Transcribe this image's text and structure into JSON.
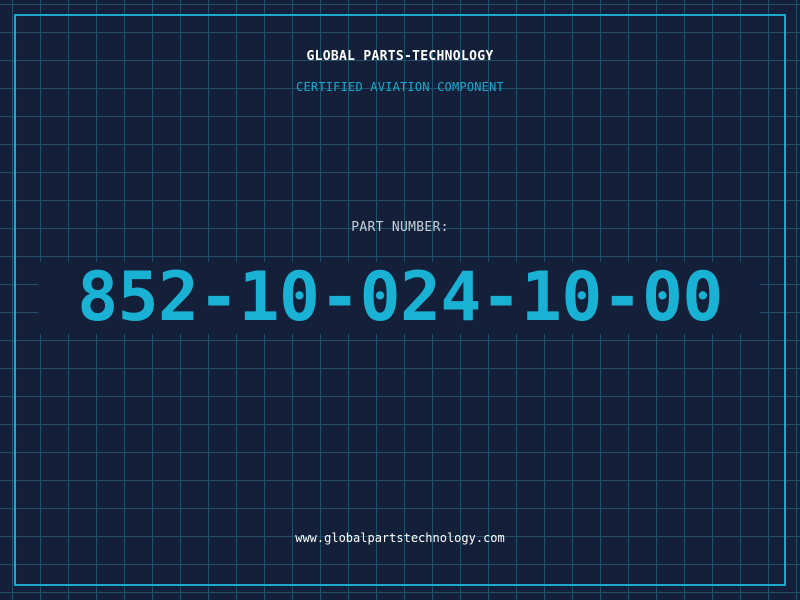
{
  "header": {
    "brand": "GLOBAL PARTS-TECHNOLOGY",
    "subtitle": "CERTIFIED AVIATION COMPONENT"
  },
  "part": {
    "label": "PART NUMBER:",
    "number": "852-10-024-10-00"
  },
  "footer": {
    "url": "www.globalpartstechnology.com"
  },
  "colors": {
    "background": "#14203a",
    "grid": "#22506a",
    "accent": "#1aa9cc",
    "text": "#ffffff"
  }
}
